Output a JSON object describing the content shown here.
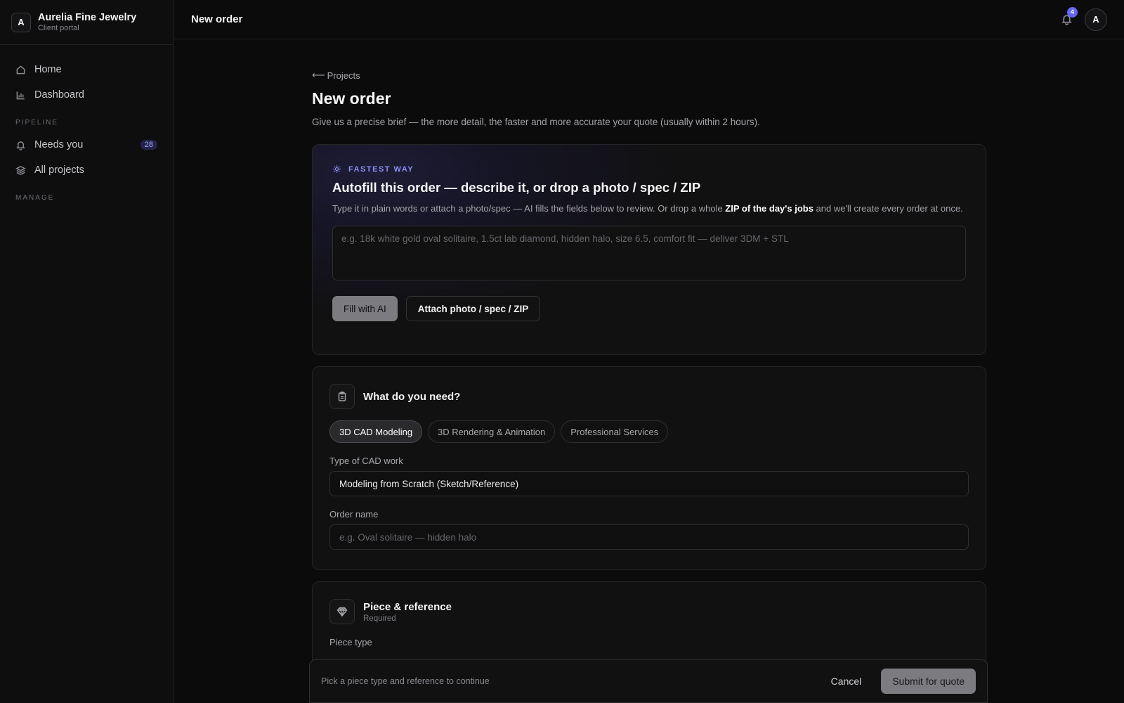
{
  "brand": {
    "logo_letter": "A",
    "name": "Aurelia Fine Jewelry",
    "subtitle": "Client portal"
  },
  "sidebar": {
    "items_top": [
      {
        "label": "Home",
        "icon": "home-icon"
      },
      {
        "label": "Dashboard",
        "icon": "chart-icon"
      }
    ],
    "section_pipeline": "PIPELINE",
    "pipeline_items": [
      {
        "label": "Needs you",
        "icon": "bell-icon",
        "badge": "28"
      },
      {
        "label": "All projects",
        "icon": "layers-icon"
      }
    ],
    "section_manage": "MANAGE"
  },
  "topbar": {
    "title": "New order",
    "notification_count": "4",
    "avatar_letter": "A"
  },
  "page": {
    "back_label": "Projects",
    "title": "New order",
    "subtitle": "Give us a precise brief — the more detail, the faster and more accurate your quote (usually within 2 hours)."
  },
  "autofill": {
    "eyebrow": "FASTEST WAY",
    "title": "Autofill this order — describe it, or drop a photo / spec / ZIP",
    "desc_before": "Type it in plain words or attach a photo/spec — AI fills the fields below to review. Or drop a whole ",
    "desc_bold": "ZIP of the day's jobs",
    "desc_after": " and we'll create every order at once.",
    "placeholder": "e.g. 18k white gold oval solitaire, 1.5ct lab diamond, hidden halo, size 6.5, comfort fit — deliver 3DM + STL",
    "fill_button": "Fill with AI",
    "attach_button": "Attach photo / spec / ZIP"
  },
  "need": {
    "title": "What do you need?",
    "pills": [
      "3D CAD Modeling",
      "3D Rendering & Animation",
      "Professional Services"
    ],
    "active_pill": 0,
    "cad_label": "Type of CAD work",
    "cad_value": "Modeling from Scratch (Sketch/Reference)",
    "order_label": "Order name",
    "order_placeholder": "e.g. Oval solitaire — hidden halo"
  },
  "piece": {
    "title": "Piece & reference",
    "subtitle": "Required",
    "piece_type_label": "Piece type"
  },
  "footer": {
    "hint": "Pick a piece type and reference to continue",
    "cancel": "Cancel",
    "submit": "Submit for quote"
  },
  "colors": {
    "accent": "#6366f1",
    "background": "#0b0b0c",
    "card": "#111112"
  }
}
